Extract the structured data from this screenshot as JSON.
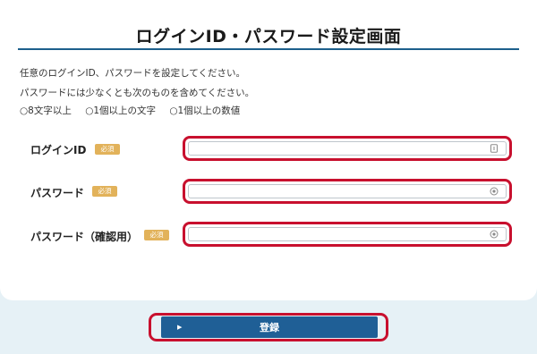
{
  "page": {
    "title": "ログインID・パスワード設定画面"
  },
  "intro": {
    "line1": "任意のログインID、パスワードを設定してください。",
    "line2": "パスワードには少なくとも次のものを含めてください。"
  },
  "requirements": [
    "○8文字以上",
    "○1個以上の文字",
    "○1個以上の数値"
  ],
  "fields": [
    {
      "label": "ログインID",
      "badge": "必須",
      "value": "",
      "icon": "id-card-icon"
    },
    {
      "label": "パスワード",
      "badge": "必須",
      "value": "",
      "icon": "eye-icon"
    },
    {
      "label": "パスワード（確認用）",
      "badge": "必須",
      "value": "",
      "icon": "eye-icon"
    }
  ],
  "submit": {
    "label": "登録"
  },
  "colors": {
    "accent": "#1f5f96",
    "highlight": "#c8102e",
    "badge": "#e2b25a",
    "footer_bg": "#e6f1f6"
  }
}
